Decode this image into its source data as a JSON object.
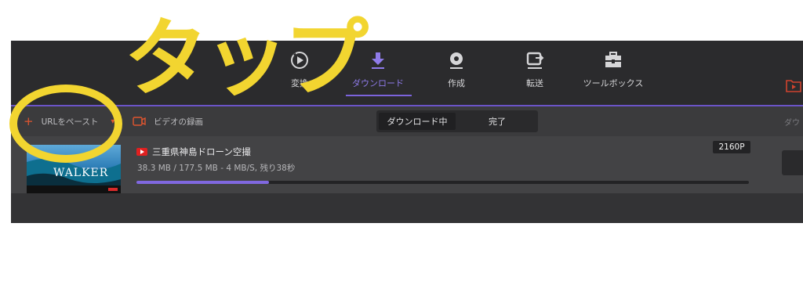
{
  "annotation": {
    "text": "タップ",
    "color": "#f2d530"
  },
  "nav": {
    "items": [
      {
        "label": "変換",
        "icon": "convert-icon"
      },
      {
        "label": "ダウンロード",
        "icon": "download-icon",
        "active": true
      },
      {
        "label": "作成",
        "icon": "disc-icon"
      },
      {
        "label": "転送",
        "icon": "transfer-icon"
      },
      {
        "label": "ツールボックス",
        "icon": "toolbox-icon"
      }
    ],
    "accent": "#7b63dc"
  },
  "toolbar": {
    "paste_url": "URLをペースト",
    "record_video": "ビデオの録画",
    "tab_downloading": "ダウンロード中",
    "tab_completed": "完了",
    "right_clip": "ダウ"
  },
  "download": {
    "title": "三重県神島ドローン空撮",
    "meta": "38.3 MB / 177.5 MB - 4 MB/S, 残り38秒",
    "resolution": "2160P",
    "progress": 0.216,
    "thumbnail_text": "WALKER"
  }
}
